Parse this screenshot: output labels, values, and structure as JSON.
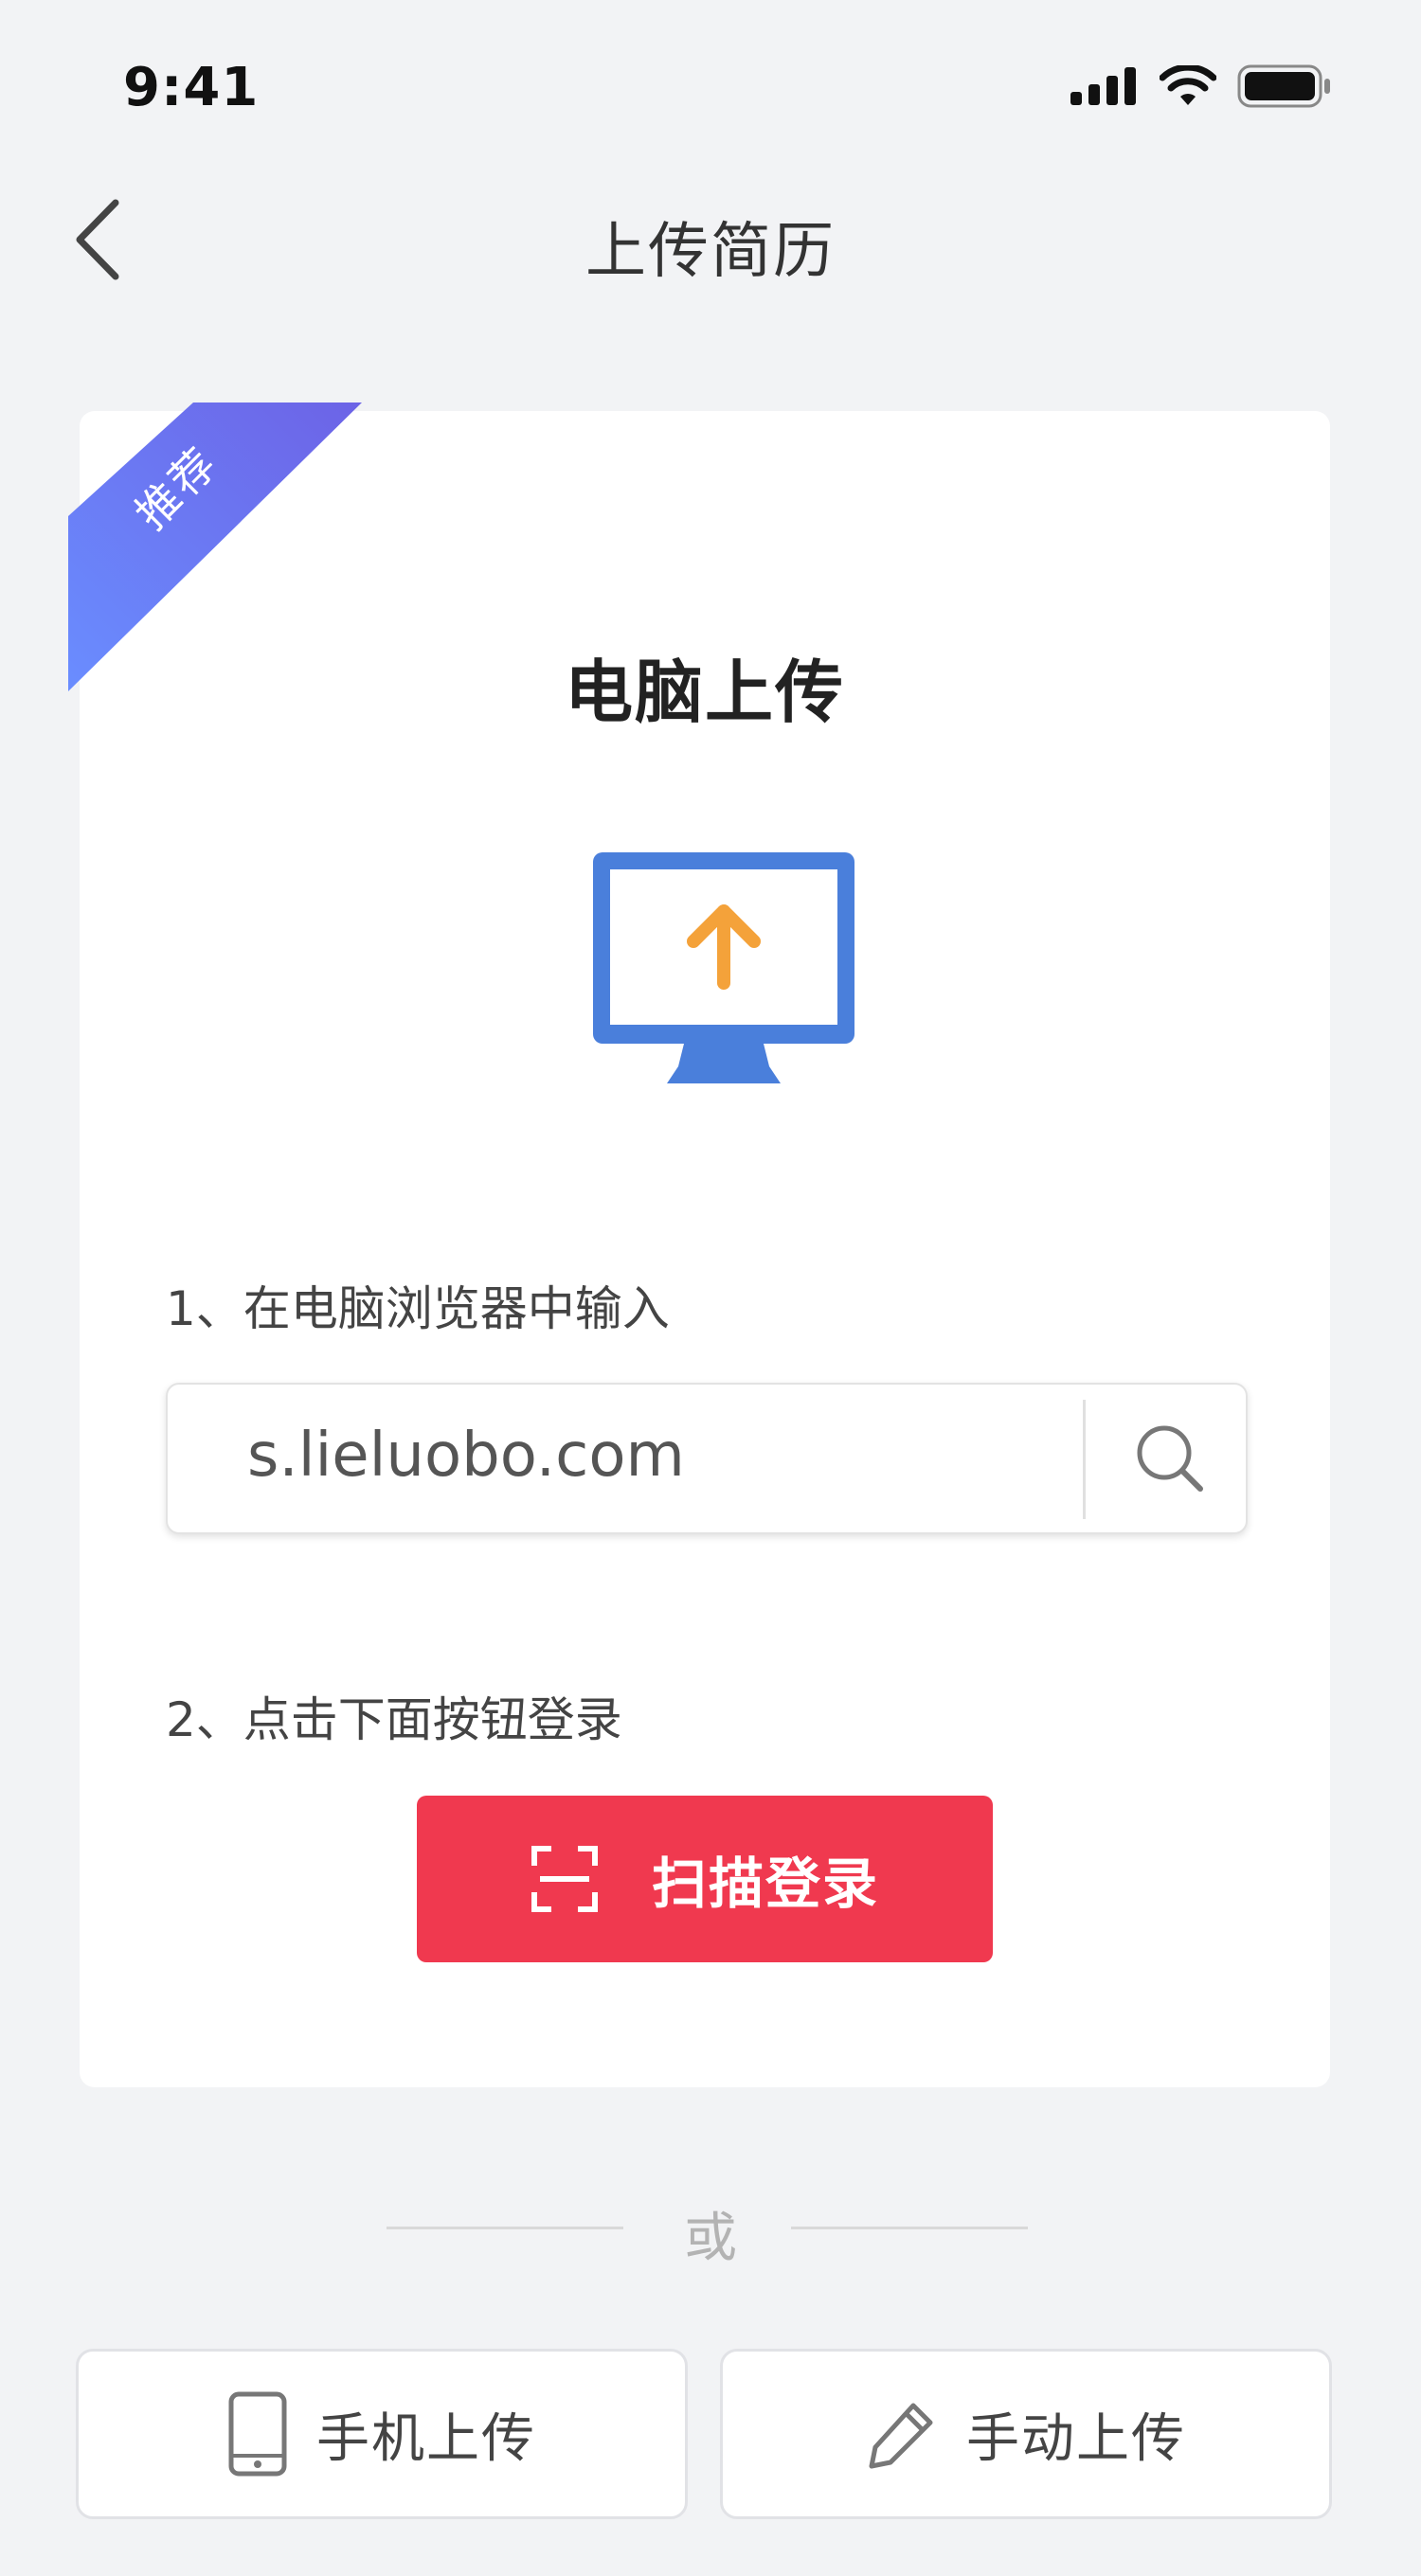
{
  "status_bar": {
    "time": "9:41",
    "icons": [
      "signal-icon",
      "wifi-icon",
      "battery-icon"
    ]
  },
  "nav": {
    "back_icon": "chevron-left-icon",
    "title": "上传简历"
  },
  "card": {
    "badge": "推荐",
    "title": "电脑上传",
    "illustration": "monitor-upload-icon",
    "step1": "1、在电脑浏览器中输入",
    "url": "s.lieluobo.com",
    "search_icon": "search-icon",
    "step2": "2、点击下面按钮登录",
    "scan_button": {
      "icon": "scan-icon",
      "label": "扫描登录"
    }
  },
  "divider_text": "或",
  "options": [
    {
      "icon": "phone-icon",
      "label": "手机上传"
    },
    {
      "icon": "pencil-icon",
      "label": "手动上传"
    }
  ],
  "colors": {
    "accent": "#f0394f",
    "monitor_blue": "#4a7fdb",
    "arrow_orange": "#f4a23a",
    "ribbon_start": "#6a8dff",
    "ribbon_end": "#6c63e6",
    "background": "#f2f3f5"
  }
}
